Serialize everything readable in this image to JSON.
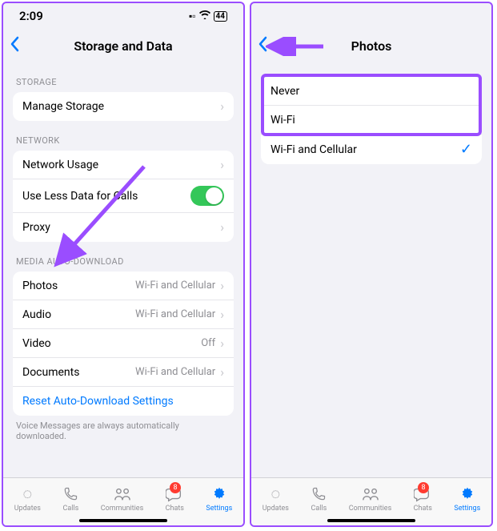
{
  "status": {
    "time": "2:09",
    "battery": "44"
  },
  "left": {
    "title": "Storage and Data",
    "sections": {
      "storage": {
        "header": "STORAGE",
        "manage": "Manage Storage"
      },
      "network": {
        "header": "NETWORK",
        "usage": "Network Usage",
        "lessdata": "Use Less Data for Calls",
        "proxy": "Proxy"
      },
      "media": {
        "header": "MEDIA AUTO-DOWNLOAD",
        "photos_label": "Photos",
        "photos_value": "Wi-Fi and Cellular",
        "audio_label": "Audio",
        "audio_value": "Wi-Fi and Cellular",
        "video_label": "Video",
        "video_value": "Off",
        "docs_label": "Documents",
        "docs_value": "Wi-Fi and Cellular",
        "reset": "Reset Auto-Download Settings",
        "footer": "Voice Messages are always automatically downloaded."
      }
    }
  },
  "right": {
    "title": "Photos",
    "options": {
      "never": "Never",
      "wifi": "Wi-Fi",
      "both": "Wi-Fi and Cellular"
    }
  },
  "tabs": {
    "updates": "Updates",
    "calls": "Calls",
    "communities": "Communities",
    "chats": "Chats",
    "chats_badge": "8",
    "settings": "Settings"
  }
}
